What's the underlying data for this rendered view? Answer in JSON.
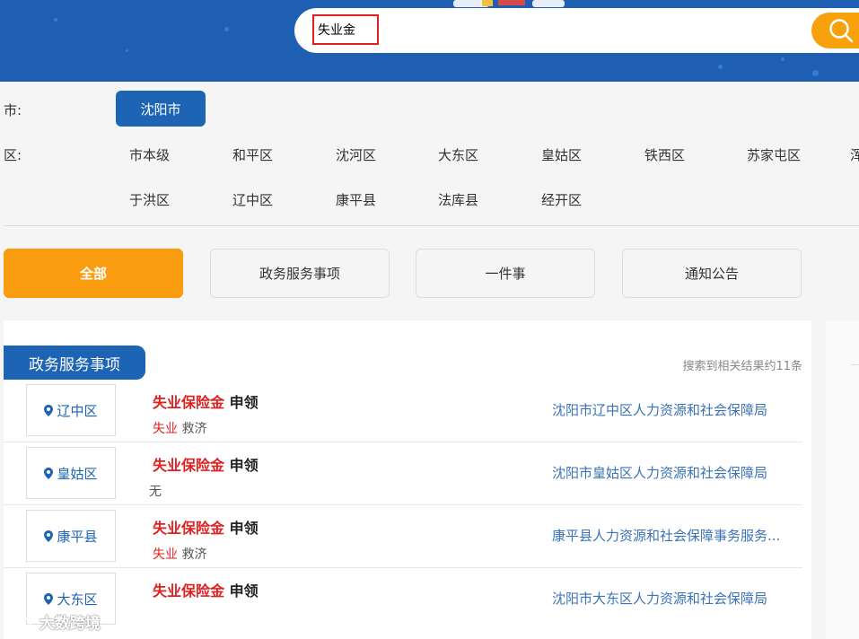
{
  "search": {
    "value": "失业金"
  },
  "filters": {
    "city_label": "市:",
    "city_selected": "沈阳市",
    "district_label": "区:",
    "districts_row1": [
      "市本级",
      "和平区",
      "沈河区",
      "大东区",
      "皇姑区",
      "铁西区",
      "苏家屯区",
      "浑"
    ],
    "districts_row2": [
      "于洪区",
      "辽中区",
      "康平县",
      "法库县",
      "经开区"
    ]
  },
  "categories": [
    "全部",
    "政务服务事项",
    "一件事",
    "通知公告"
  ],
  "results": {
    "section_title": "政务服务事项",
    "count_text": "搜索到相关结果约11条",
    "items": [
      {
        "location": "辽中区",
        "title_hl": "失业保险金",
        "title_rest": " 申领",
        "tag_hl": "失业",
        "tag_rest": " 救济",
        "dept": "沈阳市辽中区人力资源和社会保障局"
      },
      {
        "location": "皇姑区",
        "title_hl": "失业保险金",
        "title_rest": " 申领",
        "tag_hl": "",
        "tag_rest": "无",
        "dept": "沈阳市皇姑区人力资源和社会保障局"
      },
      {
        "location": "康平县",
        "title_hl": "失业保险金",
        "title_rest": " 申领",
        "tag_hl": "失业",
        "tag_rest": " 救济",
        "dept": "康平县人力资源和社会保障事务服务..."
      },
      {
        "location": "大东区",
        "title_hl": "失业保险金",
        "title_rest": " 申领",
        "tag_hl": "",
        "tag_rest": "",
        "dept": "沈阳市大东区人力资源和社会保障局"
      }
    ]
  },
  "watermark": "大数跨境",
  "colors": {
    "header_blue": "#1f5fb3",
    "accent_orange": "#fa9c0f",
    "highlight_red": "#e02020",
    "link_blue": "#3a73b8"
  }
}
